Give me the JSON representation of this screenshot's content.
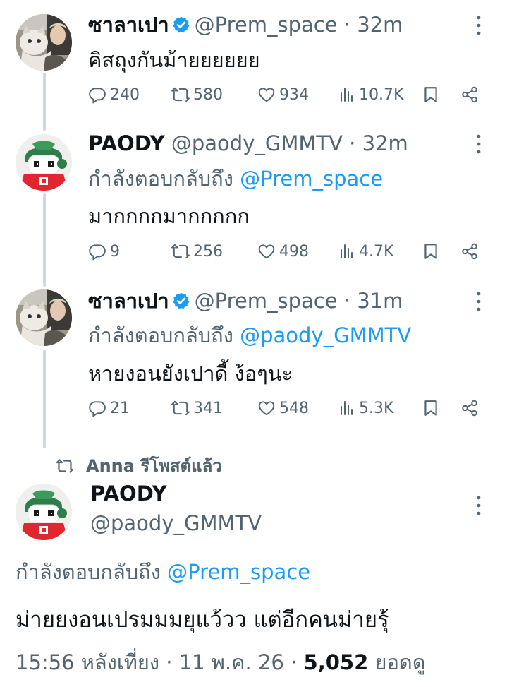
{
  "tweets": [
    {
      "name": "ซาลาเปา",
      "handle": "@Prem_space",
      "time": "32m",
      "verified": true,
      "replying_label": "",
      "replying_to": "",
      "text": "คิสถุงกันม้ายยยยยย",
      "replies": "240",
      "retweets": "580",
      "likes": "934",
      "views": "10.7K"
    },
    {
      "name": "PAODY",
      "handle": "@paody_GMMTV",
      "time": "32m",
      "verified": false,
      "replying_label": "กำลังตอบกลับถึง",
      "replying_to": "@Prem_space",
      "text": "มากกกกมากกกกก",
      "replies": "9",
      "retweets": "256",
      "likes": "498",
      "views": "4.7K"
    },
    {
      "name": "ซาลาเปา",
      "handle": "@Prem_space",
      "time": "31m",
      "verified": true,
      "replying_label": "กำลังตอบกลับถึง",
      "replying_to": "@paody_GMMTV",
      "text": "หายงอนยังเปาดี้ ง้อๆนะ",
      "replies": "21",
      "retweets": "341",
      "likes": "548",
      "views": "5.3K"
    }
  ],
  "repost_banner": "Anna รีโพสต์แล้ว",
  "main_tweet": {
    "name": "PAODY",
    "handle": "@paody_GMMTV",
    "replying_label": "กำลังตอบกลับถึง",
    "replying_to": "@Prem_space",
    "text": "ม่ายยงอนเปรมมมยุแว้วว แต่อีกคนม่ายรุ้",
    "time": "15:56 หลังเที่ยง",
    "date": "11 พ.ค. 26",
    "views_count": "5,052",
    "views_label": "ยอดดู"
  },
  "colors": {
    "accent": "#1d9bf0",
    "muted": "#536471",
    "thread_line": "#cfd9de",
    "text": "#0f1419"
  },
  "icons": [
    "reply-icon",
    "retweet-icon",
    "like-icon",
    "views-icon",
    "bookmark-icon",
    "share-icon",
    "verified-icon",
    "more-icon",
    "repost-icon"
  ]
}
